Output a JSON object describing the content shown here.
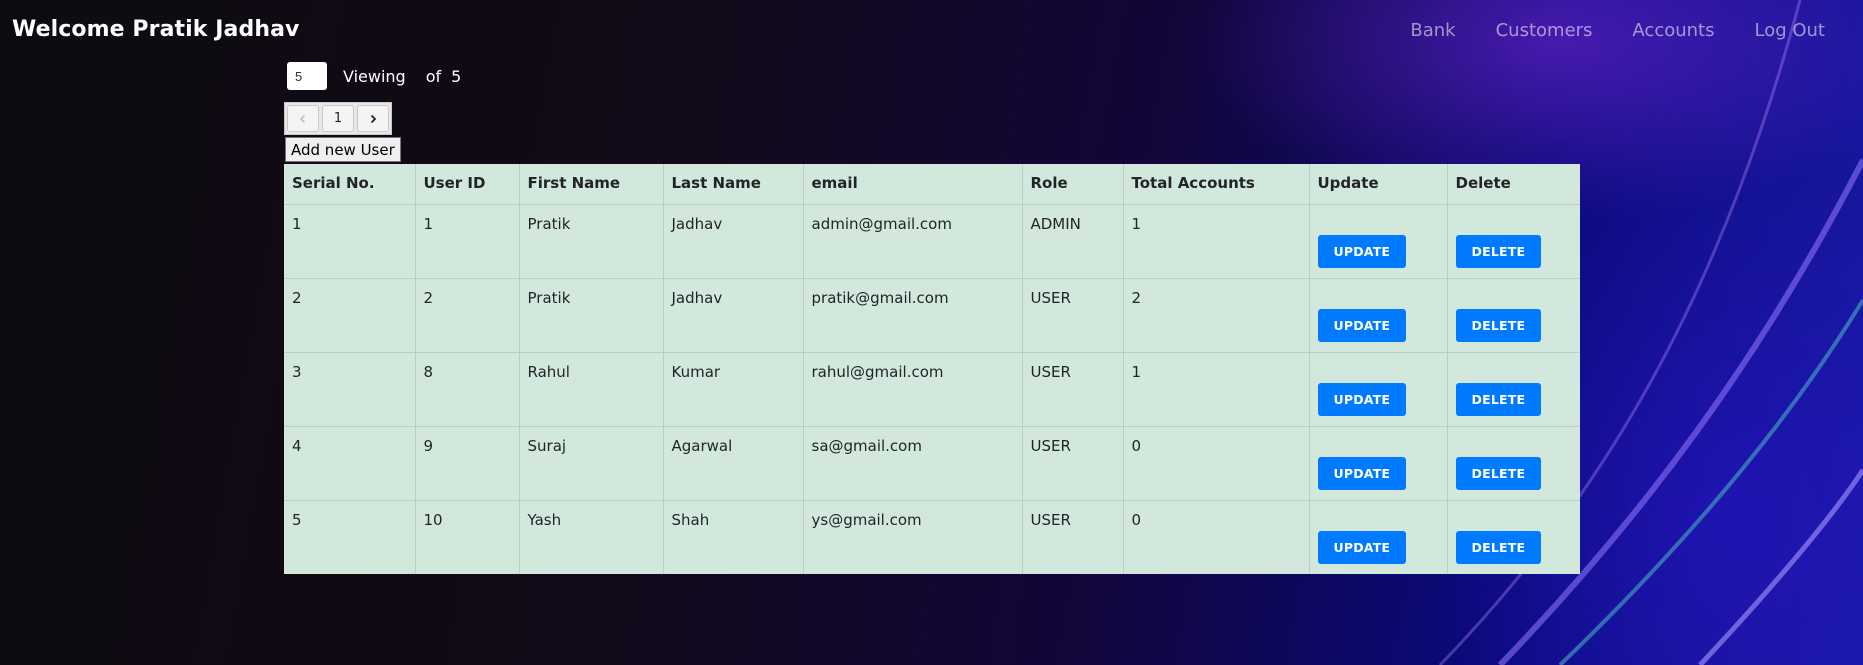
{
  "navbar": {
    "brand": "Welcome Pratik Jadhav",
    "links": [
      "Bank",
      "Customers",
      "Accounts",
      "Log Out"
    ]
  },
  "controls": {
    "page_size_value": "5",
    "viewing_label": "Viewing",
    "of_label": "of",
    "total": "5"
  },
  "pager": {
    "prev_icon": "chevron-left-icon",
    "current_page": "1",
    "next_icon": "chevron-right-icon"
  },
  "add_user_label": "Add new User",
  "table": {
    "headers": [
      "Serial No.",
      "User ID",
      "First Name",
      "Last Name",
      "email",
      "Role",
      "Total Accounts",
      "Update",
      "Delete"
    ],
    "rows": [
      {
        "serial": "1",
        "user_id": "1",
        "first_name": "Pratik",
        "last_name": "Jadhav",
        "email": "admin@gmail.com",
        "role": "ADMIN",
        "total_accounts": "1",
        "update_label": "UPDATE",
        "delete_label": "DELETE"
      },
      {
        "serial": "2",
        "user_id": "2",
        "first_name": "Pratik",
        "last_name": "Jadhav",
        "email": "pratik@gmail.com",
        "role": "USER",
        "total_accounts": "2",
        "update_label": "UPDATE",
        "delete_label": "DELETE"
      },
      {
        "serial": "3",
        "user_id": "8",
        "first_name": "Rahul",
        "last_name": "Kumar",
        "email": "rahul@gmail.com",
        "role": "USER",
        "total_accounts": "1",
        "update_label": "UPDATE",
        "delete_label": "DELETE"
      },
      {
        "serial": "4",
        "user_id": "9",
        "first_name": "Suraj",
        "last_name": "Agarwal",
        "email": "sa@gmail.com",
        "role": "USER",
        "total_accounts": "0",
        "update_label": "UPDATE",
        "delete_label": "DELETE"
      },
      {
        "serial": "5",
        "user_id": "10",
        "first_name": "Yash",
        "last_name": "Shah",
        "email": "ys@gmail.com",
        "role": "USER",
        "total_accounts": "0",
        "update_label": "UPDATE",
        "delete_label": "DELETE"
      }
    ]
  },
  "colors": {
    "table_bg": "#d2e8dd",
    "button_primary": "#007bff",
    "background_accent": "#1a1aa8"
  }
}
